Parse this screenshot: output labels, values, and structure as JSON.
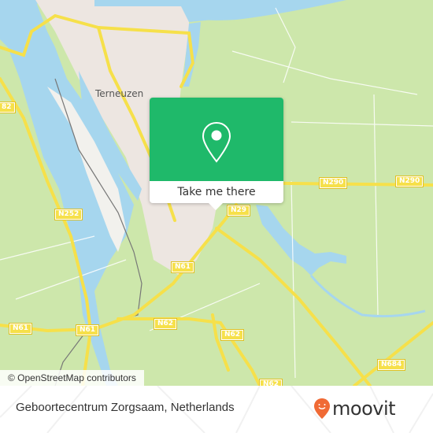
{
  "map": {
    "city_label": "Terneuzen",
    "road_labels": [
      {
        "id": "n252-left",
        "text": "82"
      },
      {
        "id": "n252",
        "text": "N252"
      },
      {
        "id": "n290-a",
        "text": "N290"
      },
      {
        "id": "n290-b",
        "text": "N290"
      },
      {
        "id": "n29-partial",
        "text": "N29"
      },
      {
        "id": "n61-a",
        "text": "N61"
      },
      {
        "id": "n61-b",
        "text": "N61"
      },
      {
        "id": "n61-c",
        "text": "N61"
      },
      {
        "id": "n62-a",
        "text": "N62"
      },
      {
        "id": "n62-b",
        "text": "N62"
      },
      {
        "id": "n684",
        "text": "N684"
      },
      {
        "id": "n62-bottom",
        "text": "N62"
      }
    ],
    "attribution": "© OpenStreetMap contributors",
    "colors": {
      "land": "#cde7ab",
      "urban": "#ede6e1",
      "water": "#a6d6ee",
      "road": "#f6e04a",
      "industrial": "#f2f1ed"
    }
  },
  "popup": {
    "icon": "map-pin-icon",
    "cta_label": "Take me there",
    "accent": "#1fb96a"
  },
  "footer": {
    "place_name": "Geboortecentrum Zorgsaam, Netherlands",
    "brand": "moovit",
    "brand_color": "#f06a35"
  }
}
